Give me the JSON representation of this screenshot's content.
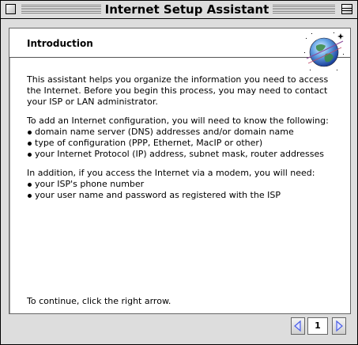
{
  "window": {
    "title": "Internet Setup Assistant"
  },
  "section": {
    "title": "Introduction",
    "logo_icon": "globe-icon"
  },
  "body": {
    "intro": "This assistant helps you organize the information you need to access the Internet.  Before you begin this process, you may need to contact your ISP or LAN administrator.",
    "config_lead": "To add an Internet configuration, you will need to know the following:",
    "config_items": [
      "domain name server (DNS) addresses and/or domain name",
      "type of configuration (PPP, Ethernet, MacIP or other)",
      "your Internet Protocol (IP) address, subnet mask, router addresses"
    ],
    "modem_lead": "In addition, if you access the Internet via a modem, you will need:",
    "modem_items": [
      "your ISP's phone number",
      "your user name and password as registered with the ISP"
    ],
    "continue": "To continue, click the right arrow."
  },
  "nav": {
    "page": "1",
    "prev_icon": "left-arrow-icon",
    "next_icon": "right-arrow-icon",
    "accent": "#4a5ee8"
  }
}
